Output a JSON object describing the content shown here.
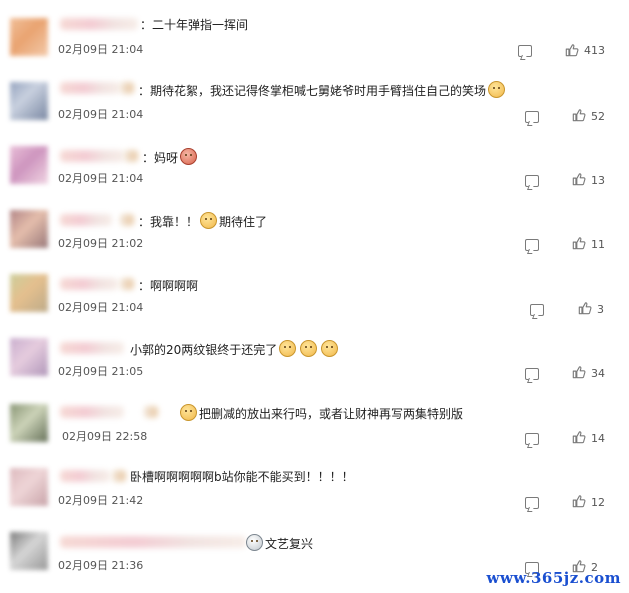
{
  "comments": [
    {
      "text": "：二十年弹指一挥间",
      "time": "02月09日 21:04",
      "likes": "413"
    },
    {
      "text": "：期待花絮，我还记得佟掌柜喊七舅姥爷时用手臂挡住自己的笑场",
      "time": "02月09日 21:04",
      "likes": "52"
    },
    {
      "text": "：妈呀",
      "time": "02月09日 21:04",
      "likes": "13"
    },
    {
      "text_a": "：我靠！！",
      "text_b": "期待住了",
      "time": "02月09日 21:02",
      "likes": "11"
    },
    {
      "text": "：啊啊啊啊",
      "time": "02月09日 21:04",
      "likes": "3"
    },
    {
      "text": "小郭的20两纹银终于还完了",
      "time": "02月09日 21:05",
      "likes": "34"
    },
    {
      "text": "把删减的放出来行吗，或者让财神再写两集特别版",
      "time": "02月09日 22:58",
      "likes": "14"
    },
    {
      "text": "卧槽啊啊啊啊啊b站你能不能买到！！！！",
      "time": "02月09日 21:42",
      "likes": "12"
    },
    {
      "text": "文艺复兴",
      "time": "02月09日 21:36",
      "likes": "2"
    }
  ],
  "watermark": "www.365jz.com",
  "icons": {
    "comment": "comment-icon",
    "like": "thumbs-up-icon"
  }
}
